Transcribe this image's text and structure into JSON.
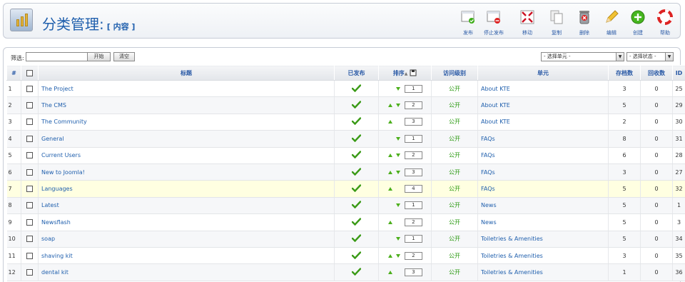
{
  "header": {
    "title": "分类管理:",
    "subtitle": "[ 内容 ]",
    "logo_icon": "category-manager-icon"
  },
  "toolbar": [
    {
      "name": "publish-button",
      "label": "发布",
      "icon": "publish-icon"
    },
    {
      "name": "unpublish-button",
      "label": "停止发布",
      "icon": "unpublish-icon"
    },
    {
      "name": "move-button",
      "label": "移动",
      "icon": "move-icon"
    },
    {
      "name": "copy-button",
      "label": "复制",
      "icon": "copy-icon"
    },
    {
      "name": "delete-button",
      "label": "删除",
      "icon": "trash-icon"
    },
    {
      "name": "edit-button",
      "label": "编辑",
      "icon": "pencil-icon"
    },
    {
      "name": "new-button",
      "label": "创建",
      "icon": "plus-circle-icon"
    },
    {
      "name": "help-button",
      "label": "帮助",
      "icon": "lifebuoy-icon"
    }
  ],
  "filter": {
    "label": "筛选:",
    "value": "",
    "go_label": "开始",
    "reset_label": "清空",
    "section_select": "- 选择单元 -",
    "state_select": "- 选择状态 -"
  },
  "columns": {
    "num": "#",
    "title": "标题",
    "published": "已发布",
    "order": "排序",
    "access": "访问级别",
    "section": "单元",
    "items": "存档数",
    "trash": "回收数",
    "id": "ID"
  },
  "rows": [
    {
      "num": "1",
      "title": "The Project",
      "up": false,
      "down": true,
      "order": "1",
      "access": "公开",
      "section": "About KTE",
      "items": "3",
      "trash": "0",
      "id": "25"
    },
    {
      "num": "2",
      "title": "The CMS",
      "up": true,
      "down": true,
      "order": "2",
      "access": "公开",
      "section": "About KTE",
      "items": "5",
      "trash": "0",
      "id": "29"
    },
    {
      "num": "3",
      "title": "The Community",
      "up": true,
      "down": false,
      "order": "3",
      "access": "公开",
      "section": "About KTE",
      "items": "2",
      "trash": "0",
      "id": "30"
    },
    {
      "num": "4",
      "title": "General",
      "up": false,
      "down": true,
      "order": "1",
      "access": "公开",
      "section": "FAQs",
      "items": "8",
      "trash": "0",
      "id": "31"
    },
    {
      "num": "5",
      "title": "Current Users",
      "up": true,
      "down": true,
      "order": "2",
      "access": "公开",
      "section": "FAQs",
      "items": "6",
      "trash": "0",
      "id": "28"
    },
    {
      "num": "6",
      "title": "New to Joomla!",
      "up": true,
      "down": true,
      "order": "3",
      "access": "公开",
      "section": "FAQs",
      "items": "3",
      "trash": "0",
      "id": "27"
    },
    {
      "num": "7",
      "title": "Languages",
      "up": true,
      "down": false,
      "order": "4",
      "access": "公开",
      "section": "FAQs",
      "items": "5",
      "trash": "0",
      "id": "32"
    },
    {
      "num": "8",
      "title": "Latest",
      "up": false,
      "down": true,
      "order": "1",
      "access": "公开",
      "section": "News",
      "items": "5",
      "trash": "0",
      "id": "1"
    },
    {
      "num": "9",
      "title": "Newsflash",
      "up": true,
      "down": false,
      "order": "2",
      "access": "公开",
      "section": "News",
      "items": "5",
      "trash": "0",
      "id": "3"
    },
    {
      "num": "10",
      "title": "soap",
      "up": false,
      "down": true,
      "order": "1",
      "access": "公开",
      "section": "Toiletries & Amenities",
      "items": "5",
      "trash": "0",
      "id": "34"
    },
    {
      "num": "11",
      "title": "shaving kit",
      "up": true,
      "down": true,
      "order": "2",
      "access": "公开",
      "section": "Toiletries & Amenities",
      "items": "3",
      "trash": "0",
      "id": "35"
    },
    {
      "num": "12",
      "title": "dental kit",
      "up": true,
      "down": false,
      "order": "3",
      "access": "公开",
      "section": "Toiletries & Amenities",
      "items": "1",
      "trash": "0",
      "id": "36"
    }
  ],
  "highlighted_row": "7",
  "colors": {
    "link": "#1f5fad",
    "check": "#3a9a16",
    "arrow": "#4caf1c",
    "highlight": "#ffffe1"
  }
}
